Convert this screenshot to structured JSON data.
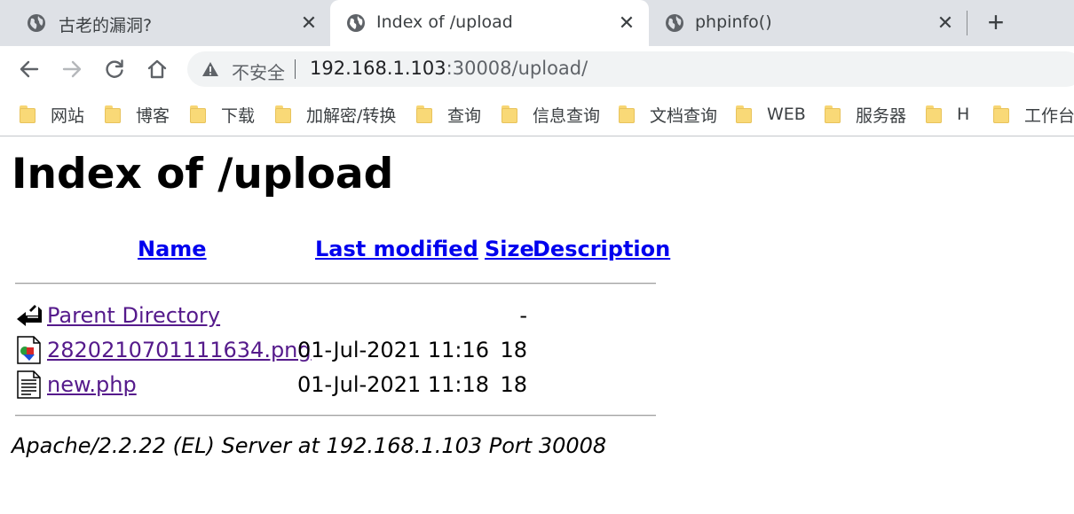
{
  "browser": {
    "tabs": [
      {
        "title": "古老的漏洞?",
        "icon": "globe-icon",
        "active": false
      },
      {
        "title": "Index of /upload",
        "icon": "globe-icon",
        "active": true
      },
      {
        "title": "phpinfo()",
        "icon": "globe-icon",
        "active": false
      }
    ],
    "new_tab_symbol": "+",
    "close_symbol": "✕",
    "security_label": "不安全",
    "url_host": "192.168.1.103",
    "url_rest": ":30008/upload/",
    "bookmarks": [
      {
        "label": "网站"
      },
      {
        "label": "博客"
      },
      {
        "label": "下载"
      },
      {
        "label": "加解密/转换"
      },
      {
        "label": "查询"
      },
      {
        "label": "信息查询"
      },
      {
        "label": "文档查询"
      },
      {
        "label": "WEB"
      },
      {
        "label": "服务器"
      },
      {
        "label": "H"
      },
      {
        "label": "工作台"
      }
    ]
  },
  "page": {
    "heading": "Index of /upload",
    "columns": {
      "name": "Name",
      "last_modified": "Last modified",
      "size": "Size",
      "description": "Description"
    },
    "rows": [
      {
        "name": "Parent Directory",
        "date": "",
        "size": "-",
        "icon": "back-icon"
      },
      {
        "name": "2820210701111634.png",
        "date": "01-Jul-2021 11:16",
        "size": "18",
        "icon": "image-file-icon"
      },
      {
        "name": "new.php",
        "date": "01-Jul-2021 11:18",
        "size": "18",
        "icon": "text-file-icon"
      }
    ],
    "footer": "Apache/2.2.22 (EL) Server at 192.168.1.103 Port 30008"
  },
  "colors": {
    "tabstrip": "#dee1e6",
    "link": "#0000ee",
    "visited_link": "#551a8b",
    "folder": "#f9d977"
  }
}
